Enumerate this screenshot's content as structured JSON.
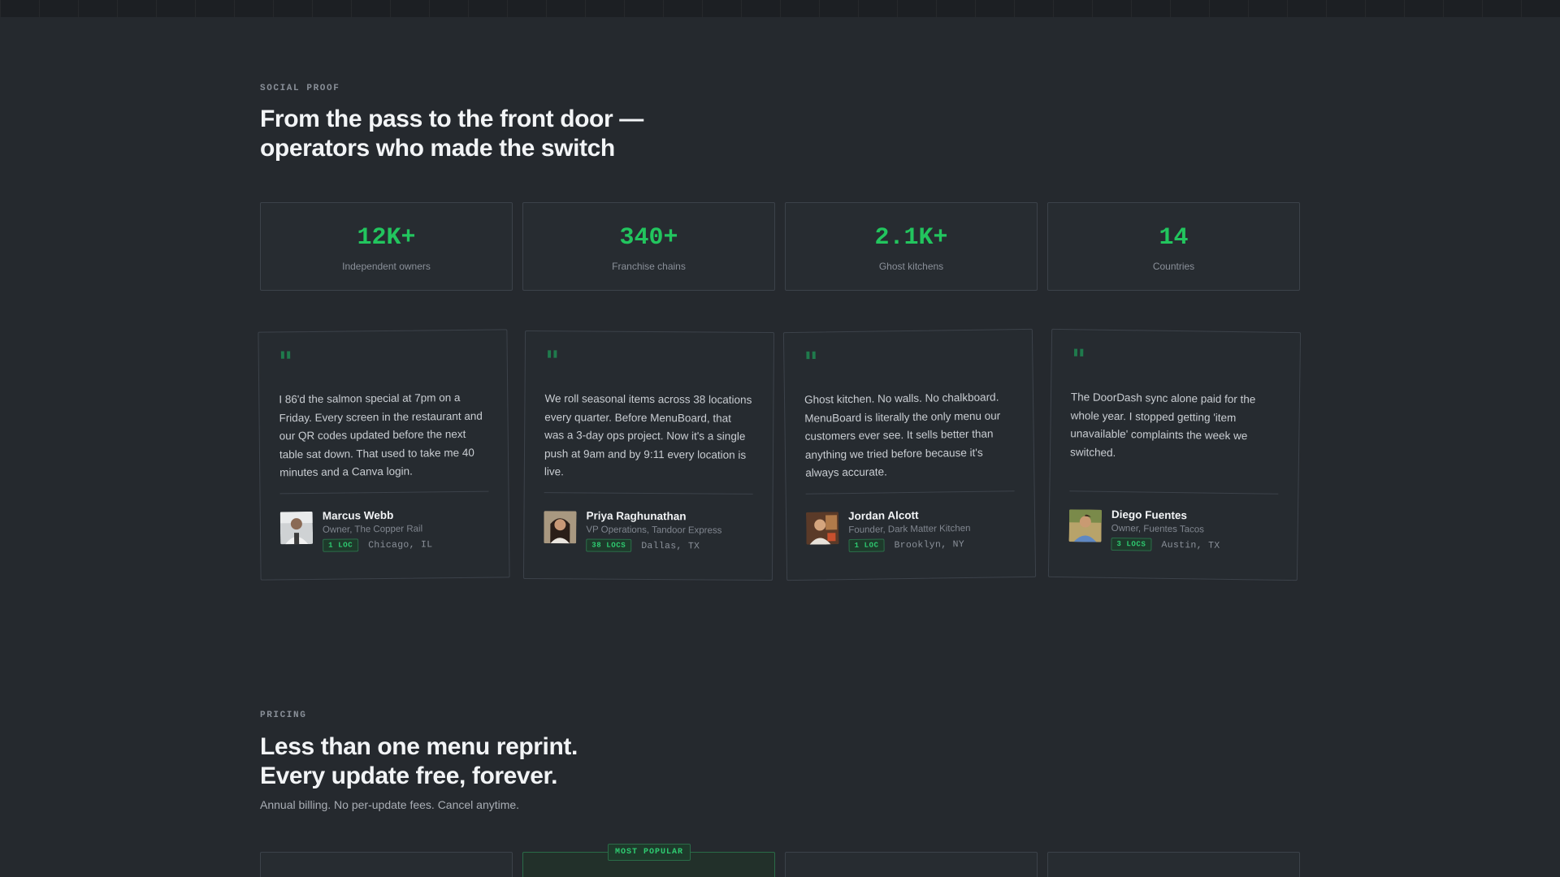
{
  "social": {
    "eyebrow": "SOCIAL PROOF",
    "headline_line1": "From the pass to the front door —",
    "headline_line2": "operators who made the switch"
  },
  "stats": [
    {
      "value": "12K+",
      "label": "Independent owners"
    },
    {
      "value": "340+",
      "label": "Franchise chains"
    },
    {
      "value": "2.1K+",
      "label": "Ghost kitchens"
    },
    {
      "value": "14",
      "label": "Countries"
    }
  ],
  "testimonials": [
    {
      "quote": "I 86'd the salmon special at 7pm on a Friday. Every screen in the restaurant and our QR codes updated before the next table sat down. That used to take me 40 minutes and a Canva login.",
      "name": "Marcus Webb",
      "role": "Owner, The Copper Rail",
      "badge": "1 LOC",
      "location": "Chicago, IL"
    },
    {
      "quote": "We roll seasonal items across 38 locations every quarter. Before MenuBoard, that was a 3-day ops project. Now it's a single push at 9am and by 9:11 every location is live.",
      "name": "Priya Raghunathan",
      "role": "VP Operations, Tandoor Express",
      "badge": "38 LOCS",
      "location": "Dallas, TX"
    },
    {
      "quote": "Ghost kitchen. No walls. No chalkboard. MenuBoard is literally the only menu our customers ever see. It sells better than anything we tried before because it's always accurate.",
      "name": "Jordan Alcott",
      "role": "Founder, Dark Matter Kitchen",
      "badge": "1 LOC",
      "location": "Brooklyn, NY"
    },
    {
      "quote": "The DoorDash sync alone paid for the whole year. I stopped getting 'item unavailable' complaints the week we switched.",
      "name": "Diego Fuentes",
      "role": "Owner, Fuentes Tacos",
      "badge": "3 LOCS",
      "location": "Austin, TX"
    }
  ],
  "pricing": {
    "eyebrow": "PRICING",
    "headline_line1": "Less than one menu reprint.",
    "headline_line2": "Every update free, forever.",
    "subtext": "Annual billing. No per-update fees. Cancel anytime.",
    "popular_badge": "MOST POPULAR"
  },
  "colors": {
    "background": "#25292e",
    "accent": "#22c55e",
    "card_border": "#3c424a"
  }
}
